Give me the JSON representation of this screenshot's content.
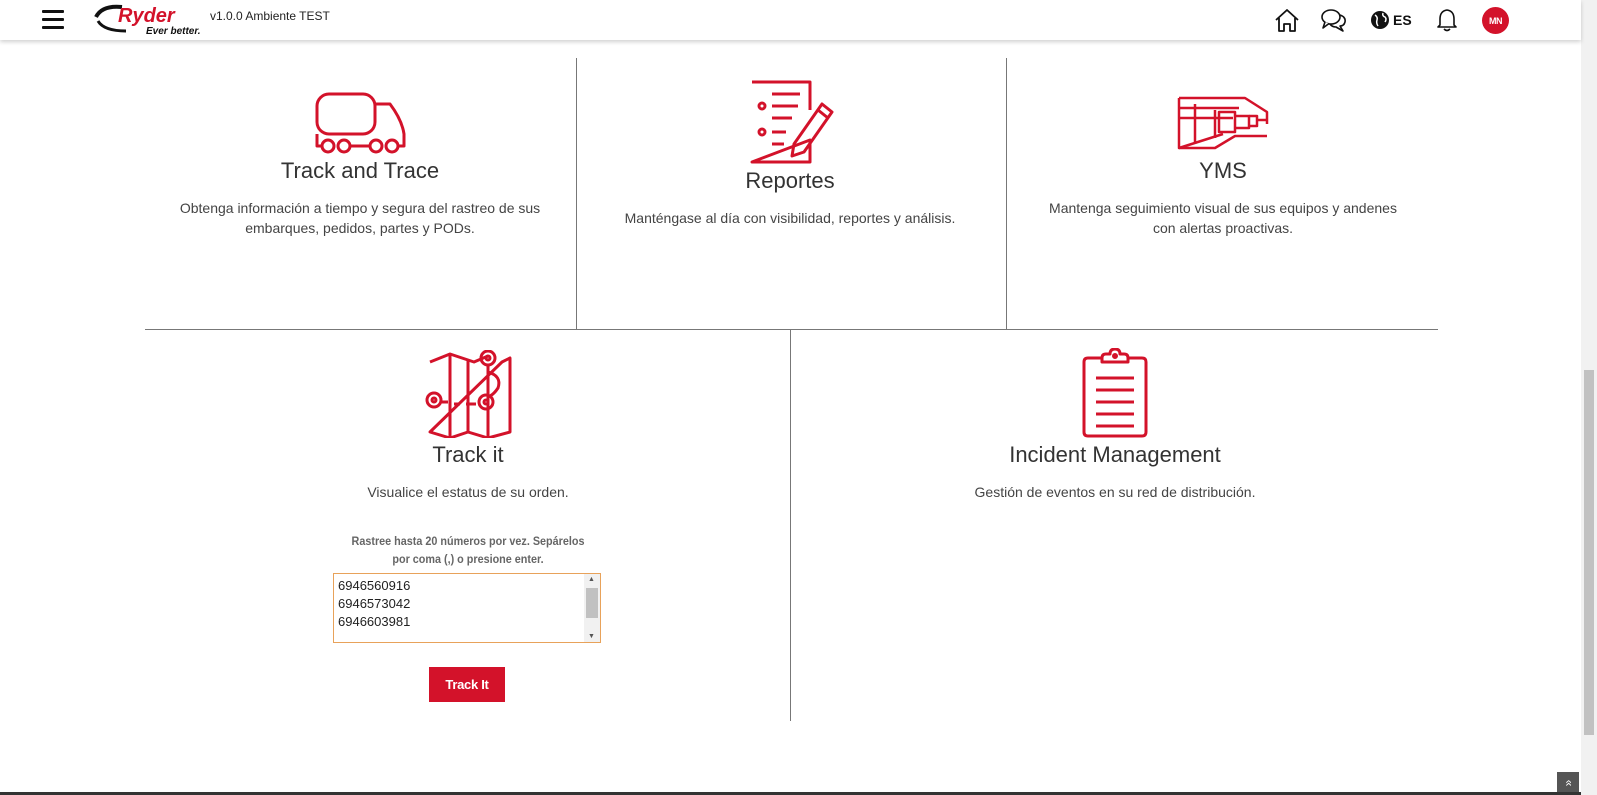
{
  "header": {
    "logo_text": "Ryder",
    "logo_tagline": "Ever better.",
    "version": "v1.0.0 Ambiente TEST",
    "language": "ES",
    "avatar_initials": "MN",
    "icons": [
      "menu-icon",
      "home-icon",
      "chat-icon",
      "globe-icon",
      "bell-icon"
    ]
  },
  "cards": {
    "track_trace": {
      "title": "Track and Trace",
      "desc": "Obtenga información a tiempo y segura del rastreo de sus embarques, pedidos, partes y PODs.",
      "icon": "truck-icon"
    },
    "reportes": {
      "title": "Reportes",
      "desc": "Manténgase al día con visibilidad, reportes y análisis.",
      "icon": "report-icon"
    },
    "yms": {
      "title": "YMS",
      "desc": "Mantenga seguimiento visual de sus equipos y andenes con alertas proactivas.",
      "icon": "yard-icon"
    },
    "track_it": {
      "title": "Track it",
      "desc": "Visualice el estatus de su orden.",
      "icon": "map-route-icon",
      "help": "Rastree hasta 20 números por vez. Sepárelos por coma (,) o presione enter.",
      "numbers": "6946560916\n6946573042\n6946603981",
      "button": "Track It"
    },
    "incident": {
      "title": "Incident Management",
      "desc": "Gestión de eventos en su red de distribución.",
      "icon": "clipboard-icon"
    }
  },
  "colors": {
    "brand_red": "#d3122a",
    "focus_border": "#e8a25a"
  }
}
